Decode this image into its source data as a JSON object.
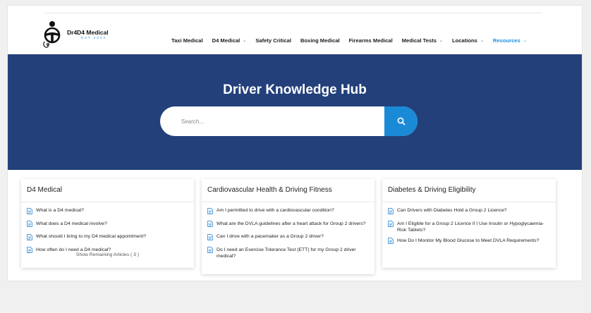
{
  "logo": {
    "brand": "Dr4D4 Medical",
    "tagline": "EST 2024"
  },
  "nav": [
    {
      "label": "Taxi Medical",
      "dropdown": false,
      "active": false
    },
    {
      "label": "D4 Medical",
      "dropdown": true,
      "active": false
    },
    {
      "label": "Safety Critical",
      "dropdown": false,
      "active": false
    },
    {
      "label": "Boxing Medical",
      "dropdown": false,
      "active": false
    },
    {
      "label": "Firearms Medical",
      "dropdown": false,
      "active": false
    },
    {
      "label": "Medical Tests",
      "dropdown": true,
      "active": false
    },
    {
      "label": "Locations",
      "dropdown": true,
      "active": false
    },
    {
      "label": "Resources",
      "dropdown": true,
      "active": true
    }
  ],
  "hero": {
    "title": "Driver Knowledge Hub",
    "search_placeholder": "Search..."
  },
  "cards": [
    {
      "title": "D4 Medical",
      "articles": [
        "What is a D4 medical?",
        "What does a D4 medical involve?",
        "What should I bring to my D4 medical appointment?",
        "How often do I need a D4 medical?"
      ],
      "more": "Show Remaining Articles ( 3 )"
    },
    {
      "title": "Cardiovascular Health & Driving Fitness",
      "articles": [
        "Am I permitted to drive with a cardiovascular condition?",
        "What are the DVLA guidelines after a heart attack for Group 2 drivers?",
        "Can I drive with a pacemaker as a Group 2 driver?",
        "Do I need an Exercise Tolerance Test (ETT) for my Group 2 driver medical?"
      ]
    },
    {
      "title": "Diabetes & Driving Eligibility",
      "articles": [
        "Can Drivers with Diabetes Hold a Group 2 Licence?",
        "Am I Eligible for a Group 2 Licence if I Use Insulin or Hypoglycaemia-Risk Tablets?",
        "How Do I Monitor My Blood Glucose to Meet DVLA Requirements?"
      ]
    }
  ],
  "colors": {
    "hero_bg": "#23407a",
    "accent": "#1b8ad6",
    "doc_icon": "#3a8fd6"
  }
}
